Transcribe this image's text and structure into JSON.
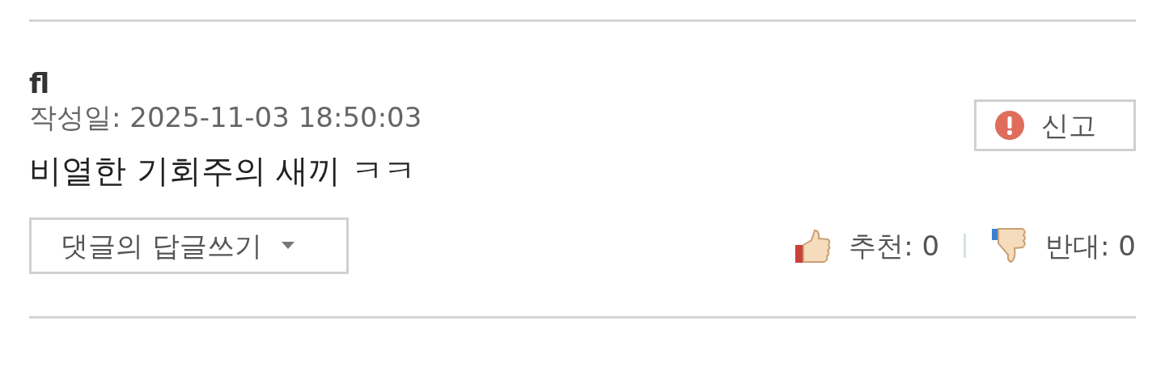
{
  "comment": {
    "author": "fl",
    "date": "작성일: 2025-11-03 18:50:03",
    "report_button": "신고",
    "body": "비열한 기회주의 새끼 ㅋㅋ",
    "reply_button": "댓글의 답글쓰기",
    "votes": [
      {
        "kind": "up",
        "label": "추천: 0"
      },
      {
        "kind": "down",
        "label": "반대: 0"
      }
    ]
  }
}
